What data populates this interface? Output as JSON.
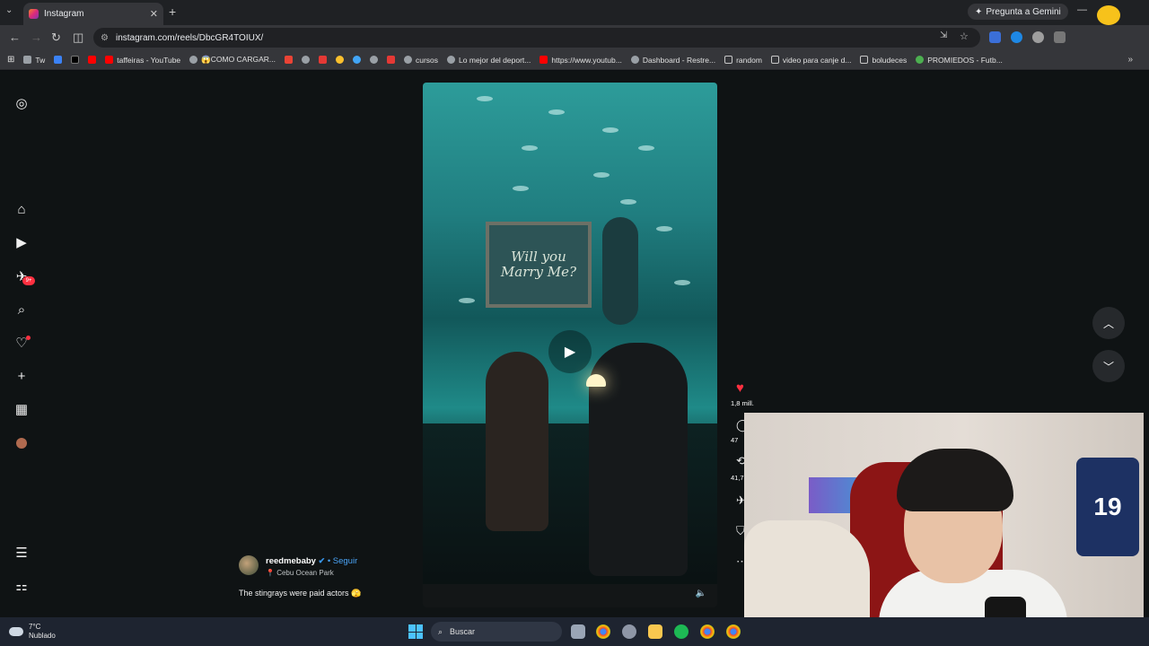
{
  "browser": {
    "tab_title": "Instagram",
    "url": "instagram.com/reels/DbcGR4TOIUX/",
    "gemini_label": "Pregunta a Gemini"
  },
  "bookmarks": [
    {
      "label": "Tw",
      "color": "#9aa0a6"
    },
    {
      "label": "",
      "color": "#3b82f6"
    },
    {
      "label": "",
      "color": "#000000"
    },
    {
      "label": "",
      "color": "#ff0000"
    },
    {
      "label": "taffeiras - YouTube",
      "color": "#ff0000"
    },
    {
      "label": "😱COMO CARGAR...",
      "color": "#9aa0a6"
    },
    {
      "label": "",
      "color": "#ea4335"
    },
    {
      "label": "",
      "color": "#9aa0a6"
    },
    {
      "label": "",
      "color": "#e53935"
    },
    {
      "label": "",
      "color": "#fbc02d"
    },
    {
      "label": "",
      "color": "#42a5f5"
    },
    {
      "label": "",
      "color": "#9aa0a6"
    },
    {
      "label": "",
      "color": "#e53935"
    },
    {
      "label": "cursos",
      "color": "#9aa0a6"
    },
    {
      "label": "Lo mejor del deport...",
      "color": "#9aa0a6"
    },
    {
      "label": "https://www.youtub...",
      "color": "#ff0000"
    },
    {
      "label": "Dashboard - Restre...",
      "color": "#9aa0a6"
    },
    {
      "label": "random",
      "color": "#9aa0a6"
    },
    {
      "label": "video para canje d...",
      "color": "#9aa0a6"
    },
    {
      "label": "boludeces",
      "color": "#9aa0a6"
    },
    {
      "label": "PROMIEDOS - Futb...",
      "color": "#4caf50"
    }
  ],
  "sidebar": {
    "notifications_badge": "9+"
  },
  "reel": {
    "sign_text": "Will you Marry Me?"
  },
  "caption": {
    "username": "reedmebaby",
    "follow": "Seguir",
    "location": "Cebu Ocean Park",
    "text": "The stingrays were paid actors 🫣"
  },
  "actions": {
    "likes": "1,8 mill.",
    "comments": "47",
    "shares": "41,7"
  },
  "taskbar": {
    "temperature": "7°C",
    "weather": "Nublado",
    "search_label": "Buscar"
  },
  "webcam": {
    "jersey_number": "19"
  }
}
